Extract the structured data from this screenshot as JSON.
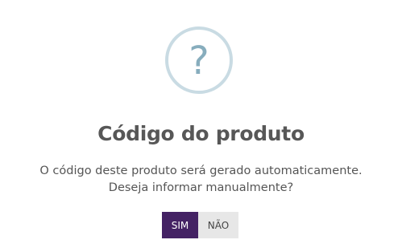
{
  "dialog": {
    "icon": "question-mark-icon",
    "icon_glyph": "?",
    "title": "Código do produto",
    "message_line1": "O código deste produto será gerado automaticamente.",
    "message_line2": "Deseja informar manualmente?",
    "confirm_label": "SIM",
    "cancel_label": "NÃO"
  },
  "colors": {
    "icon_ring": "#c9dbe3",
    "icon_glyph": "#87adbd",
    "confirm_bg": "#442264",
    "cancel_bg": "#e7e7e7",
    "title_text": "#575757"
  }
}
